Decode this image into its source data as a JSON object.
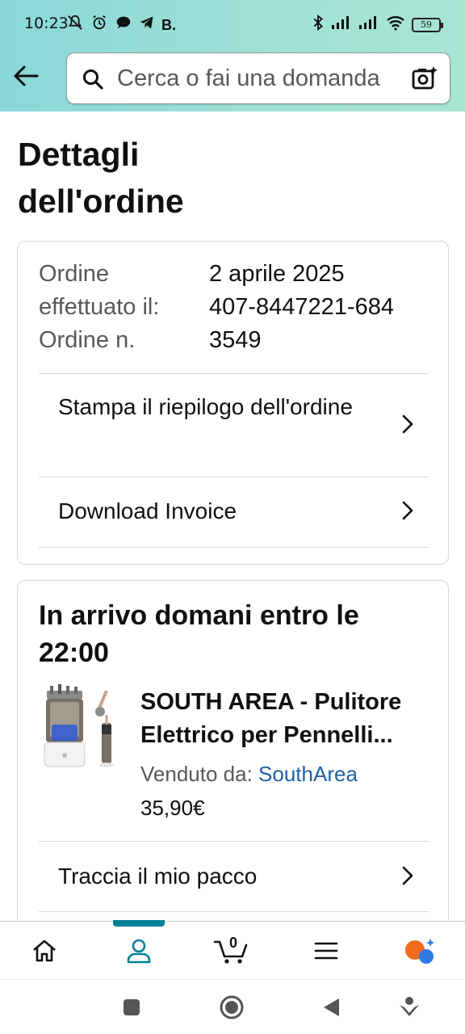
{
  "status_bar": {
    "time": "10:23",
    "extra": "B.",
    "battery": "59"
  },
  "search": {
    "placeholder": "Cerca o fai una domanda"
  },
  "page": {
    "title": "Dettagli dell'ordine"
  },
  "order_info": {
    "date_label": "Ordine effettuato il:",
    "date_value": "2 aprile 2025",
    "number_label": "Ordine n.",
    "number_value": "407-8447221-6843549"
  },
  "links": {
    "print_summary": "Stampa il riepilogo dell'ordine",
    "download_invoice": "Download Invoice"
  },
  "shipment": {
    "delivery_text": "In arrivo domani entro le 22:00",
    "product_title": "SOUTH AREA - Pulitore Elettrico per Pennelli...",
    "sold_by_label": "Venduto da:",
    "seller": "SouthArea",
    "price": "35,90€",
    "track_label": "Traccia il mio pacco"
  },
  "bottom_nav": {
    "cart_count": "0",
    "active": "account"
  },
  "colors": {
    "accent": "#008296",
    "link": "#2162a1",
    "header_gradient_start": "#89d8d9",
    "header_gradient_end": "#a9e5d3"
  }
}
